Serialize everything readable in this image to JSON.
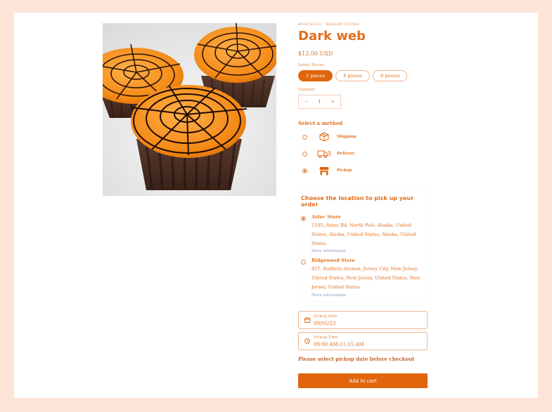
{
  "product": {
    "vendor": "BORCELLE - BAKERY STORE",
    "title": "Dark web",
    "price": "$12.00 USD"
  },
  "pieces": {
    "label": "Select Pieces",
    "options": [
      "2 pieces",
      "4 pieces",
      "6 pieces"
    ],
    "selected": "2 pieces"
  },
  "quantity": {
    "label": "Quantity",
    "minus": "−",
    "value": "1",
    "plus": "+"
  },
  "method": {
    "title": "Select a method",
    "options": [
      {
        "label": "Shipping",
        "icon": "box-icon"
      },
      {
        "label": "Delivery",
        "icon": "truck-icon"
      },
      {
        "label": "Pickup",
        "icon": "store-icon"
      }
    ],
    "selected": "Pickup"
  },
  "pickup": {
    "title": "Choose the location to pick up your order",
    "stores": [
      {
        "name": "Aztec Store",
        "address": "1105, Aztec Rd, North Pole, Alaska, United States, Alaska, United States, Alaska, United States",
        "more": "More information"
      },
      {
        "name": "Ridgewood Store",
        "address": "457, Baldwin Avenue, Jersey City, New Jersey, United States, New Jersey, United States, New Jersey, United States",
        "more": "More information"
      }
    ],
    "selected": "Aztec Store"
  },
  "pickup_date": {
    "label": "Pickup Date",
    "value": "09/05/23",
    "icon": "calendar-icon"
  },
  "pickup_time": {
    "label": "Pickup Time",
    "value": "09:00 AM-11:15 AM",
    "icon": "clock-icon"
  },
  "note": "Please select pickup date before checkout",
  "cart": {
    "label": "Add to cart"
  },
  "colors": {
    "accent": "#e0650d",
    "background": "#fde4d8",
    "text": "#e0701c"
  }
}
